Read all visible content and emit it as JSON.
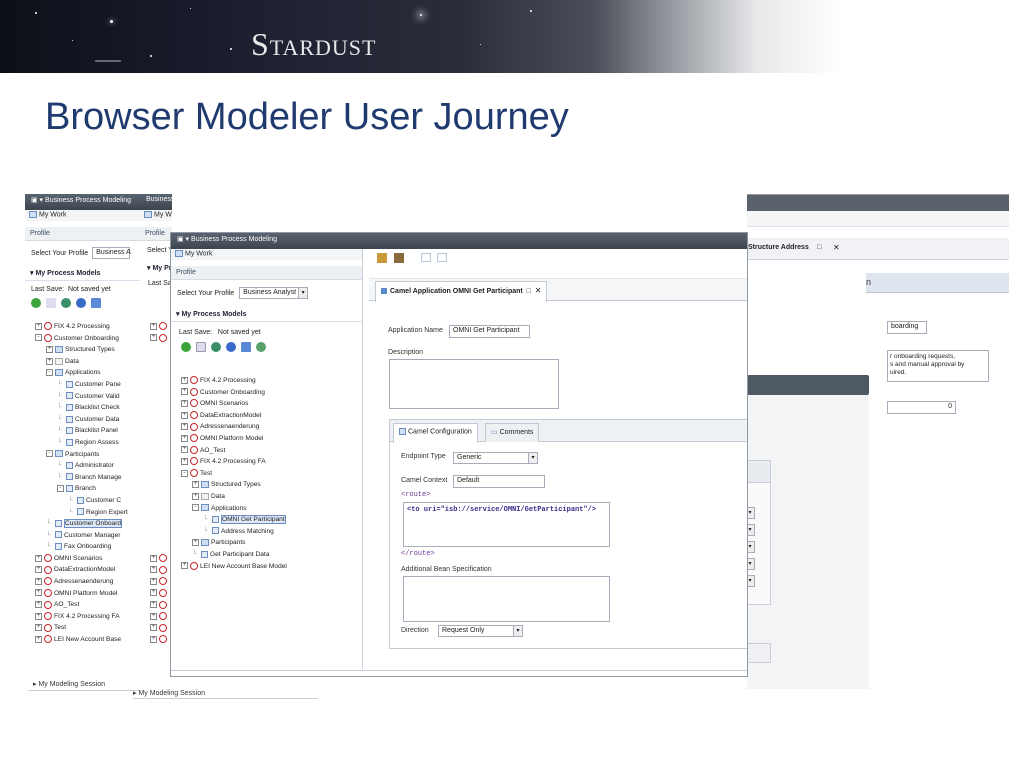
{
  "brand": "Stardust",
  "slide_title": "Browser Modeler User Journey",
  "window_title": "Business Process Modeling",
  "my_work": "My Work",
  "profile_header": "Profile",
  "select_profile_label": "Select Your Profile",
  "profile_value_short": "Business A",
  "profile_value": "Business Analyst",
  "process_models_header": "My Process Models",
  "last_save_label": "Last Save:",
  "last_save_value": "Not saved yet",
  "modeling_session": "My Modeling Session",
  "tree_left": [
    {
      "label": "FIX 4.2 Processing",
      "type": "model",
      "toggle": "+",
      "level": 0
    },
    {
      "label": "Customer Onboarding",
      "type": "model",
      "toggle": "-",
      "level": 0
    },
    {
      "label": "Structured Types",
      "type": "folder",
      "toggle": "+",
      "level": 1
    },
    {
      "label": "Data",
      "type": "page",
      "toggle": "+",
      "level": 1
    },
    {
      "label": "Applications",
      "type": "folder",
      "toggle": "-",
      "level": 1
    },
    {
      "label": "Customer Pane",
      "type": "item",
      "level": 2
    },
    {
      "label": "Customer Valid",
      "type": "item",
      "level": 2
    },
    {
      "label": "Blacklist Check",
      "type": "item",
      "level": 2
    },
    {
      "label": "Customer Data",
      "type": "item",
      "level": 2
    },
    {
      "label": "Blacklist Panel",
      "type": "item",
      "level": 2
    },
    {
      "label": "Region Assess",
      "type": "item",
      "level": 2
    },
    {
      "label": "Participants",
      "type": "folder",
      "toggle": "-",
      "level": 1
    },
    {
      "label": "Administrator",
      "type": "item",
      "level": 2
    },
    {
      "label": "Branch Manage",
      "type": "item",
      "level": 2
    },
    {
      "label": "Branch",
      "type": "item",
      "toggle": "-",
      "level": 2
    },
    {
      "label": "Customer C",
      "type": "item",
      "level": 3
    },
    {
      "label": "Region Expert",
      "type": "item",
      "level": 3
    },
    {
      "label": "Customer Onboard",
      "type": "item",
      "level": 1,
      "selected": true
    },
    {
      "label": "Customer Manager",
      "type": "item",
      "level": 1
    },
    {
      "label": "Fax Onboarding",
      "type": "item",
      "level": 1
    },
    {
      "label": "OMNI Scenarios",
      "type": "model",
      "toggle": "+",
      "level": 0
    },
    {
      "label": "DataExtractionModel",
      "type": "model",
      "toggle": "+",
      "level": 0
    },
    {
      "label": "Adressenaenderung",
      "type": "model",
      "toggle": "+",
      "level": 0
    },
    {
      "label": "OMNI Platform Model",
      "type": "model",
      "toggle": "+",
      "level": 0
    },
    {
      "label": "AO_Test",
      "type": "model",
      "toggle": "+",
      "level": 0
    },
    {
      "label": "FIX 4.2 Processing FA",
      "type": "model",
      "toggle": "+",
      "level": 0
    },
    {
      "label": "Test",
      "type": "model",
      "toggle": "+",
      "level": 0
    },
    {
      "label": "LEI New Account Base",
      "type": "model",
      "toggle": "+",
      "level": 0
    }
  ],
  "tree_front": [
    {
      "label": "FIX 4.2 Processing",
      "type": "model",
      "toggle": "+",
      "level": 0
    },
    {
      "label": "Customer Onboarding",
      "type": "model",
      "toggle": "+",
      "level": 0
    },
    {
      "label": "OMNI Scenarios",
      "type": "model",
      "toggle": "+",
      "level": 0
    },
    {
      "label": "DataExtractionModel",
      "type": "model",
      "toggle": "+",
      "level": 0
    },
    {
      "label": "Adressenaenderung",
      "type": "model",
      "toggle": "+",
      "level": 0
    },
    {
      "label": "OMNI Platform Model",
      "type": "model",
      "toggle": "+",
      "level": 0
    },
    {
      "label": "AO_Test",
      "type": "model",
      "toggle": "+",
      "level": 0
    },
    {
      "label": "FIX 4.2 Processing FA",
      "type": "model",
      "toggle": "+",
      "level": 0
    },
    {
      "label": "Test",
      "type": "model",
      "toggle": "-",
      "level": 0
    },
    {
      "label": "Structured Types",
      "type": "folder",
      "toggle": "+",
      "level": 1
    },
    {
      "label": "Data",
      "type": "page",
      "toggle": "+",
      "level": 1
    },
    {
      "label": "Applications",
      "type": "folder",
      "toggle": "-",
      "level": 1
    },
    {
      "label": "OMNI Get Participant",
      "type": "item",
      "level": 2,
      "selected": true
    },
    {
      "label": "Address Matching",
      "type": "item",
      "level": 2
    },
    {
      "label": "Participants",
      "type": "folder",
      "toggle": "+",
      "level": 1
    },
    {
      "label": "Get Participant Data",
      "type": "item",
      "level": 1
    },
    {
      "label": "LEI New Account Base Model",
      "type": "model",
      "toggle": "+",
      "level": 0
    }
  ],
  "editor_tab_title": "Camel Application OMNI Get Participant",
  "close_symbol": "✕",
  "app_name_label": "Application Name",
  "app_name_value": "OMNI Get Participant",
  "description_label": "Description",
  "subtab_config": "Camel Configuration",
  "subtab_comments": "Comments",
  "endpoint_type_label": "Endpoint Type",
  "endpoint_type_value": "Generic",
  "camel_context_label": "Camel Context",
  "camel_context_value": "Default",
  "route_open": "<route>",
  "route_body": "<to uri=\"isb://service/OMNI/GetParticipant\"/>",
  "route_close": "</route>",
  "bean_spec_label": "Additional Bean Specification",
  "direction_label": "Direction",
  "direction_value": "Request Only",
  "back_tab_title": "Structure Address",
  "back_header": "n",
  "back_field_1": "boarding",
  "back_desc_lines": [
    "r onboarding requests,",
    "s and manual approval by",
    "uired."
  ],
  "back_number": "0",
  "icon_colors": {
    "model_ring": "#c8262a",
    "selection": "#6a8fc7",
    "title": "#1f3a6e"
  }
}
